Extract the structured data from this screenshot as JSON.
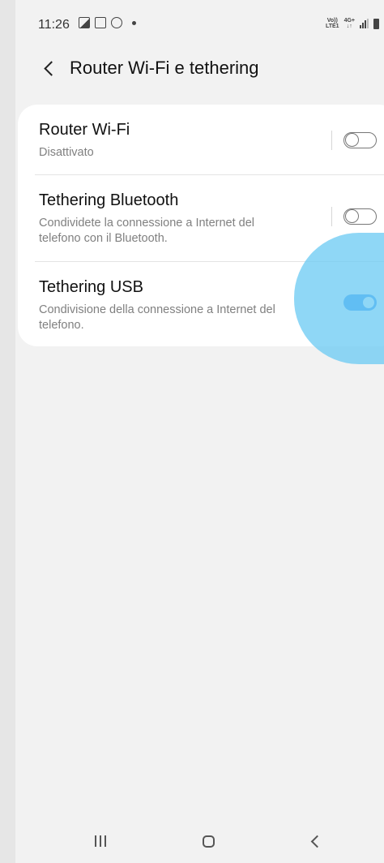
{
  "status_bar": {
    "time": "11:26",
    "notification_icons": [
      "image-icon",
      "screenshot-icon",
      "vpn-icon"
    ],
    "network_line1": "Vo))",
    "network_line2": "LTE1",
    "network_type_line1": "4G+",
    "network_type_line2": "↓↑"
  },
  "header": {
    "title": "Router Wi-Fi e tethering"
  },
  "settings": [
    {
      "title": "Router Wi-Fi",
      "subtitle": "Disattivato",
      "enabled": false
    },
    {
      "title": "Tethering Bluetooth",
      "subtitle": "Condividete la connessione a Internet del telefono con il Bluetooth.",
      "enabled": false
    },
    {
      "title": "Tethering USB",
      "subtitle": "Condivisione della connessione a Internet del telefono.",
      "enabled": true
    }
  ],
  "colors": {
    "toggle_on": "#2f8cf0",
    "touch_indicator": "#70ccf4",
    "background": "#f2f2f2"
  },
  "navbar": {
    "icons": [
      "recents-icon",
      "home-icon",
      "back-icon"
    ]
  }
}
